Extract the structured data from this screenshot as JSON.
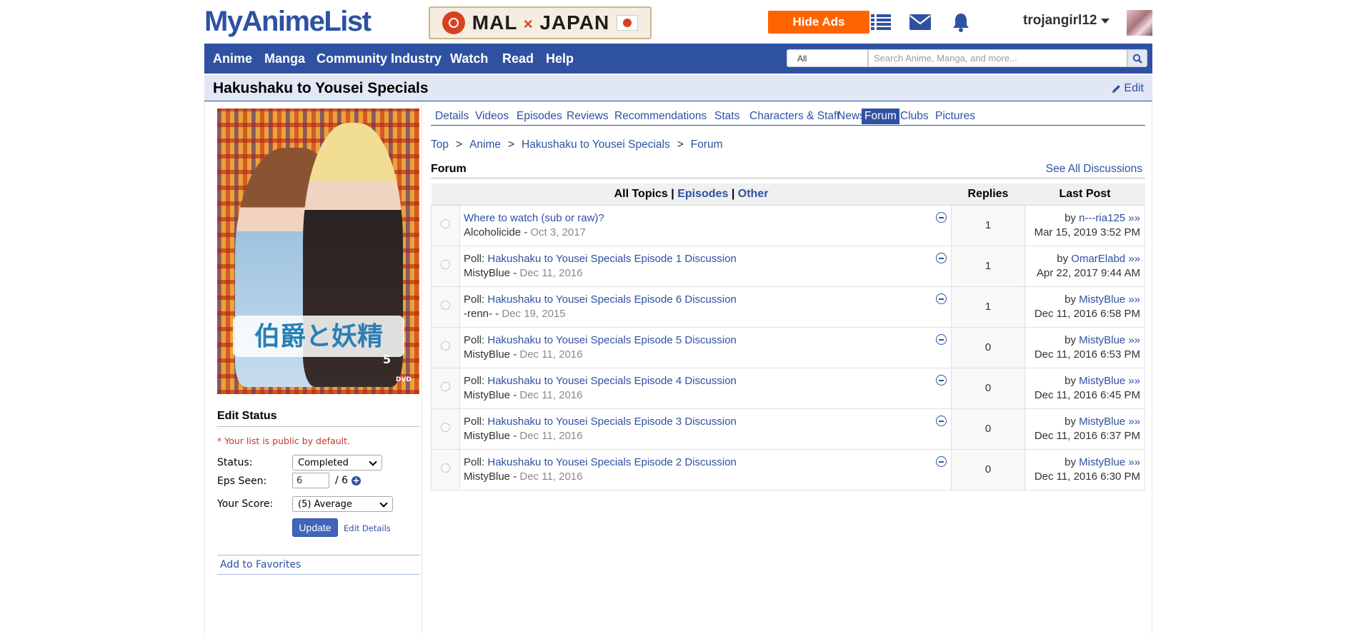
{
  "header": {
    "logo": "MyAnimeList",
    "banner_left": "MAL",
    "banner_x": "×",
    "banner_right": "JAPAN",
    "hide_ads": "Hide Ads",
    "username": "trojangirl12"
  },
  "nav": {
    "items": [
      "Anime",
      "Manga",
      "Community",
      "Industry",
      "Watch",
      "Read",
      "Help"
    ],
    "search_select": "All",
    "search_placeholder": "Search Anime, Manga, and more..."
  },
  "page": {
    "title": "Hakushaku to Yousei Specials",
    "edit": "Edit"
  },
  "cover": {
    "title_text": "伯爵と妖精",
    "volume": "5",
    "dvd": "DVD"
  },
  "sidebar": {
    "edit_status_heading": "Edit Status",
    "public_note": "* Your list is public by default.",
    "status_label": "Status:",
    "status_value": "Completed",
    "eps_label": "Eps Seen:",
    "eps_value": "6",
    "eps_total": "/ 6",
    "score_label": "Your Score:",
    "score_value": "(5) Average",
    "update": "Update",
    "edit_details": "Edit Details",
    "add_favorites": "Add to Favorites"
  },
  "tabs": [
    "Details",
    "Videos",
    "Episodes",
    "Reviews",
    "Recommendations",
    "Stats",
    "Characters & Staff",
    "News",
    "Forum",
    "Clubs",
    "Pictures"
  ],
  "active_tab": "Forum",
  "breadcrumb": {
    "items": [
      "Top",
      "Anime",
      "Hakushaku to Yousei Specials",
      "Forum"
    ],
    "separator": ">"
  },
  "forum": {
    "heading": "Forum",
    "see_all": "See All Discussions",
    "col_all_topics": "All Topics",
    "col_episodes": "Episodes",
    "col_other": "Other",
    "col_divider": "|",
    "col_replies": "Replies",
    "col_last_post": "Last Post",
    "topics": [
      {
        "prefix": "",
        "title": "Where to watch (sub or raw)?",
        "author": "Alcoholicide",
        "date": "Oct 3, 2017",
        "replies": "1",
        "last_user": "n---ria125 »»",
        "last_date": "Mar 15, 2019 3:52 PM"
      },
      {
        "prefix": "Poll: ",
        "title": "Hakushaku to Yousei Specials Episode 1 Discussion",
        "author": "MistyBlue",
        "date": "Dec 11, 2016",
        "replies": "1",
        "last_user": "OmarElabd »»",
        "last_date": "Apr 22, 2017 9:44 AM"
      },
      {
        "prefix": "Poll: ",
        "title": "Hakushaku to Yousei Specials Episode 6 Discussion",
        "author": "-renn-",
        "date": "Dec 19, 2015",
        "replies": "1",
        "last_user": "MistyBlue »»",
        "last_date": "Dec 11, 2016 6:58 PM"
      },
      {
        "prefix": "Poll: ",
        "title": "Hakushaku to Yousei Specials Episode 5 Discussion",
        "author": "MistyBlue",
        "date": "Dec 11, 2016",
        "replies": "0",
        "last_user": "MistyBlue »»",
        "last_date": "Dec 11, 2016 6:53 PM"
      },
      {
        "prefix": "Poll: ",
        "title": "Hakushaku to Yousei Specials Episode 4 Discussion",
        "author": "MistyBlue",
        "date": "Dec 11, 2016",
        "replies": "0",
        "last_user": "MistyBlue »»",
        "last_date": "Dec 11, 2016 6:45 PM"
      },
      {
        "prefix": "Poll: ",
        "title": "Hakushaku to Yousei Specials Episode 3 Discussion",
        "author": "MistyBlue",
        "date": "Dec 11, 2016",
        "replies": "0",
        "last_user": "MistyBlue »»",
        "last_date": "Dec 11, 2016 6:37 PM"
      },
      {
        "prefix": "Poll: ",
        "title": "Hakushaku to Yousei Specials Episode 2 Discussion",
        "author": "MistyBlue",
        "date": "Dec 11, 2016",
        "replies": "0",
        "last_user": "MistyBlue »»",
        "last_date": "Dec 11, 2016 6:30 PM"
      }
    ],
    "by_label": "by",
    "dash": " - "
  },
  "colors": {
    "brand_blue": "#2e51a2",
    "hide_ads_orange": "#ff6400",
    "title_bar_bg": "#e1e7f5"
  },
  "icons": [
    "list-icon",
    "mail-icon",
    "bell-icon",
    "search-icon",
    "pencil-icon",
    "plus-icon",
    "minus-icon"
  ]
}
